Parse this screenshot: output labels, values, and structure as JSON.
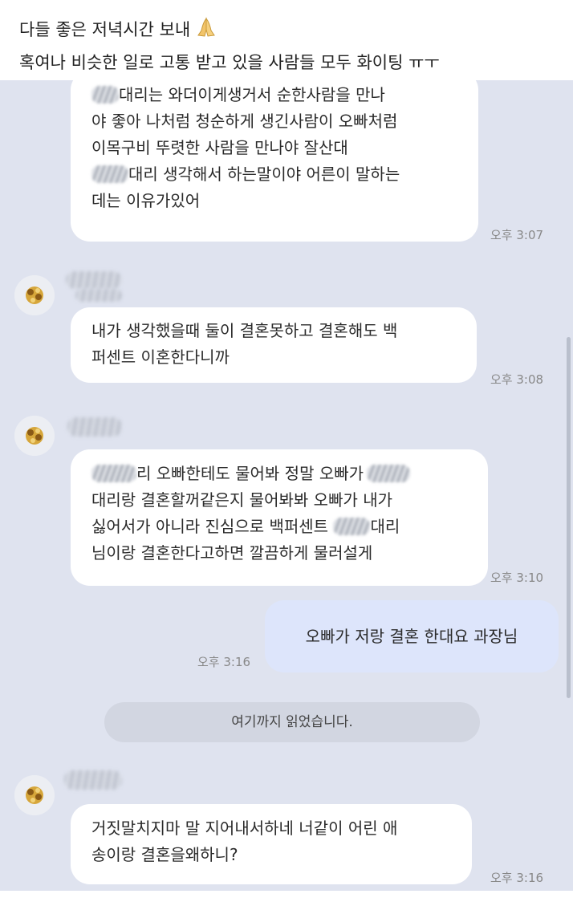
{
  "caption": {
    "line1": "다들 좋은 저녁시간 보내",
    "line2": "혹여나 비슷한 일로 고통 받고 있을 사람들 모두 화이팅 ㅠㅜ"
  },
  "messages": [
    {
      "lines": [
        "대리는 와더이게생거서 순한사람을 만나",
        "야 좋아 나처럼 청순하게 생긴사람이 오빠처럼",
        "이목구비 뚜렷한 사람을 만나야 잘산대",
        "대리 생각해서 하는말이야 어른이 말하는",
        "데는 이유가있어"
      ],
      "time": "오후 3:07"
    },
    {
      "lines": [
        "내가 생각했을때 둘이 결혼못하고 결혼해도 백",
        "퍼센트 이혼한다니까"
      ],
      "time": "오후 3:08"
    },
    {
      "lines": [
        "리 오빠한테도 물어봐 정말 오빠가",
        "대리랑 결혼할꺼같은지 물어봐봐 오빠가 내가",
        "싫어서가 아니라 진심으로 백퍼센트",
        "대리",
        "님이랑 결혼한다고하면 깔끔하게 물러설게"
      ],
      "time": "오후 3:10"
    },
    {
      "text": "오빠가 저랑 결혼 한대요 과장님",
      "time": "오후 3:16"
    },
    {
      "lines": [
        "거짓말치지마 말 지어내서하네 너같이 어린 애",
        "송이랑 결혼을왜하니?"
      ],
      "time": "오후 3:16"
    }
  ],
  "divider": "여기까지 읽었습니다.",
  "colors": {
    "chat_bg": "#dfe3ef",
    "incoming_bubble": "#ffffff",
    "outgoing_bubble": "#dde5fb",
    "divider_bg": "#d2d6e1"
  }
}
